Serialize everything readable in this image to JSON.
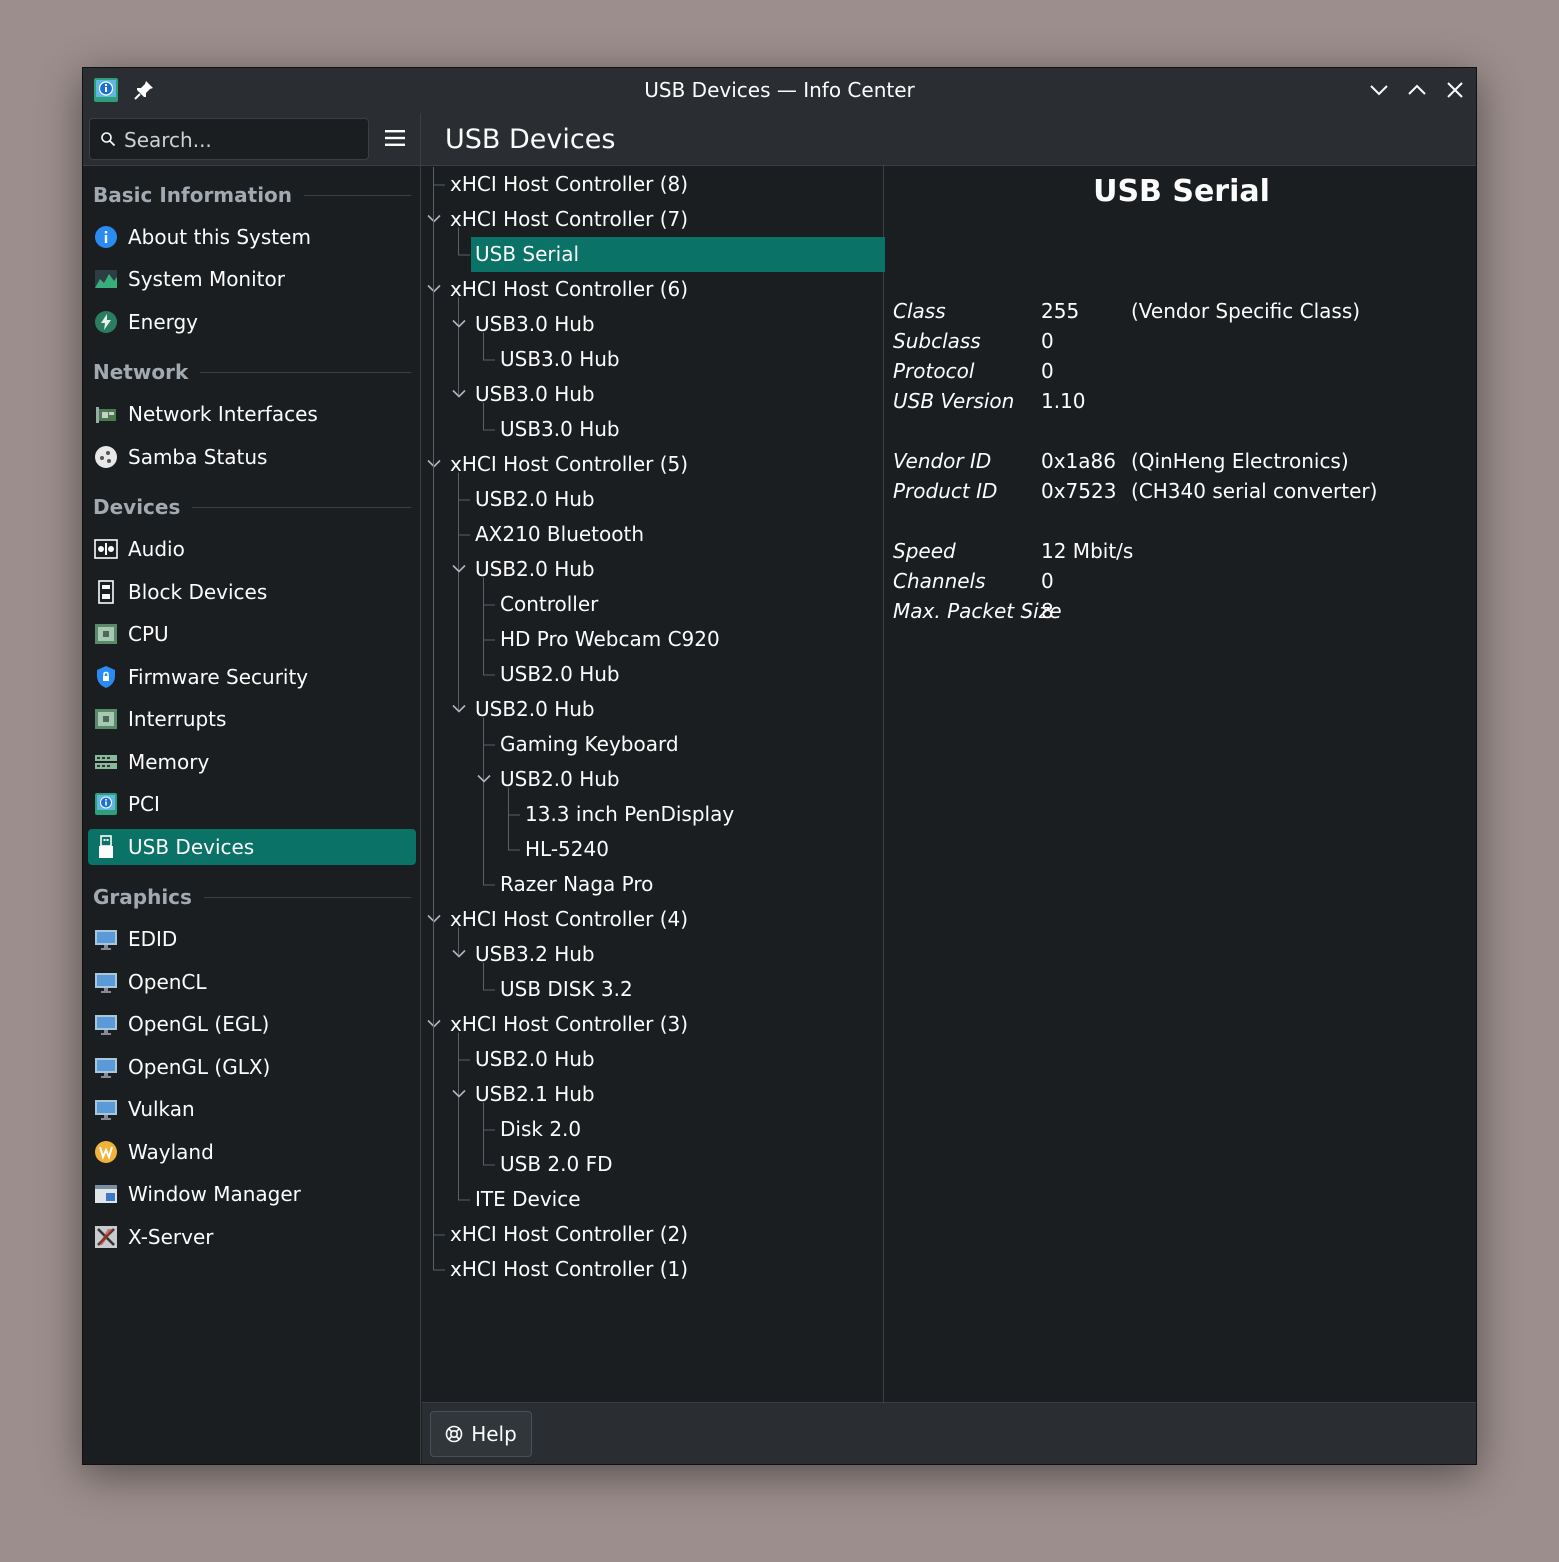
{
  "window": {
    "title": "USB Devices — Info Center"
  },
  "search": {
    "placeholder": "Search..."
  },
  "page": {
    "title": "USB Devices"
  },
  "sidebar": {
    "sections": [
      {
        "label": "Basic Information"
      },
      {
        "label": "Network"
      },
      {
        "label": "Devices"
      },
      {
        "label": "Graphics"
      }
    ],
    "items": [
      {
        "label": "About this System",
        "icon": "info-icon"
      },
      {
        "label": "System Monitor",
        "icon": "system-monitor-icon"
      },
      {
        "label": "Energy",
        "icon": "energy-icon"
      },
      {
        "label": "Network Interfaces",
        "icon": "network-card-icon"
      },
      {
        "label": "Samba Status",
        "icon": "samba-icon"
      },
      {
        "label": "Audio",
        "icon": "audio-icon"
      },
      {
        "label": "Block Devices",
        "icon": "block-device-icon"
      },
      {
        "label": "CPU",
        "icon": "cpu-icon"
      },
      {
        "label": "Firmware Security",
        "icon": "shield-icon"
      },
      {
        "label": "Interrupts",
        "icon": "interrupts-icon"
      },
      {
        "label": "Memory",
        "icon": "memory-icon"
      },
      {
        "label": "PCI",
        "icon": "pci-icon"
      },
      {
        "label": "USB Devices",
        "icon": "usb-icon"
      },
      {
        "label": "EDID",
        "icon": "monitor-icon"
      },
      {
        "label": "OpenCL",
        "icon": "monitor-icon"
      },
      {
        "label": "OpenGL (EGL)",
        "icon": "monitor-icon"
      },
      {
        "label": "OpenGL (GLX)",
        "icon": "monitor-icon"
      },
      {
        "label": "Vulkan",
        "icon": "monitor-icon"
      },
      {
        "label": "Wayland",
        "icon": "wayland-icon"
      },
      {
        "label": "Window Manager",
        "icon": "window-manager-icon"
      },
      {
        "label": "X-Server",
        "icon": "x-server-icon"
      }
    ]
  },
  "tree": [
    {
      "label": "xHCI Host Controller (8)",
      "depth": 0,
      "expanded": false
    },
    {
      "label": "xHCI Host Controller (7)",
      "depth": 0,
      "expanded": true
    },
    {
      "label": "USB Serial",
      "depth": 1,
      "expanded": false,
      "selected": true
    },
    {
      "label": "xHCI Host Controller (6)",
      "depth": 0,
      "expanded": true
    },
    {
      "label": "USB3.0 Hub",
      "depth": 1,
      "expanded": true
    },
    {
      "label": "USB3.0 Hub",
      "depth": 2,
      "expanded": false
    },
    {
      "label": "USB3.0 Hub",
      "depth": 1,
      "expanded": true
    },
    {
      "label": "USB3.0 Hub",
      "depth": 2,
      "expanded": false
    },
    {
      "label": "xHCI Host Controller (5)",
      "depth": 0,
      "expanded": true
    },
    {
      "label": "USB2.0 Hub",
      "depth": 1,
      "expanded": false
    },
    {
      "label": "AX210 Bluetooth",
      "depth": 1,
      "expanded": false
    },
    {
      "label": "USB2.0 Hub",
      "depth": 1,
      "expanded": true
    },
    {
      "label": "Controller",
      "depth": 2,
      "expanded": false
    },
    {
      "label": "HD Pro Webcam C920",
      "depth": 2,
      "expanded": false
    },
    {
      "label": "USB2.0 Hub",
      "depth": 2,
      "expanded": false
    },
    {
      "label": "USB2.0 Hub",
      "depth": 1,
      "expanded": true
    },
    {
      "label": "Gaming Keyboard",
      "depth": 2,
      "expanded": false
    },
    {
      "label": "USB2.0 Hub",
      "depth": 2,
      "expanded": true
    },
    {
      "label": "13.3 inch PenDisplay",
      "depth": 3,
      "expanded": false
    },
    {
      "label": "HL-5240",
      "depth": 3,
      "expanded": false
    },
    {
      "label": "Razer Naga Pro",
      "depth": 2,
      "expanded": false
    },
    {
      "label": "xHCI Host Controller (4)",
      "depth": 0,
      "expanded": true
    },
    {
      "label": "USB3.2 Hub",
      "depth": 1,
      "expanded": true
    },
    {
      "label": "USB DISK 3.2",
      "depth": 2,
      "expanded": false
    },
    {
      "label": "xHCI Host Controller (3)",
      "depth": 0,
      "expanded": true
    },
    {
      "label": "USB2.0 Hub",
      "depth": 1,
      "expanded": false
    },
    {
      "label": "USB2.1 Hub",
      "depth": 1,
      "expanded": true
    },
    {
      "label": "Disk 2.0",
      "depth": 2,
      "expanded": false
    },
    {
      "label": "USB 2.0 FD",
      "depth": 2,
      "expanded": false
    },
    {
      "label": "ITE Device",
      "depth": 1,
      "expanded": false
    },
    {
      "label": "xHCI Host Controller (2)",
      "depth": 0,
      "expanded": false
    },
    {
      "label": "xHCI Host Controller (1)",
      "depth": 0,
      "expanded": false
    }
  ],
  "detail": {
    "title": "USB Serial",
    "properties": [
      {
        "key": "Class",
        "value": "255",
        "desc": "(Vendor Specific Class)"
      },
      {
        "key": "Subclass",
        "value": "0",
        "desc": ""
      },
      {
        "key": "Protocol",
        "value": "0",
        "desc": ""
      },
      {
        "key": "USB Version",
        "value": "1.10",
        "desc": ""
      },
      {
        "key": "Vendor ID",
        "value": "0x1a86",
        "desc": "(QinHeng Electronics)"
      },
      {
        "key": "Product ID",
        "value": "0x7523",
        "desc": "(CH340 serial converter)"
      },
      {
        "key": "Speed",
        "value": "12 Mbit/s",
        "desc": ""
      },
      {
        "key": "Channels",
        "value": "0",
        "desc": ""
      },
      {
        "key": "Max. Packet Size",
        "value": "8",
        "desc": ""
      }
    ]
  },
  "footer": {
    "help_label": "Help"
  },
  "colors": {
    "accent": "#0a7267",
    "background": "#1b1e20",
    "titlebar": "#2a2e32"
  }
}
